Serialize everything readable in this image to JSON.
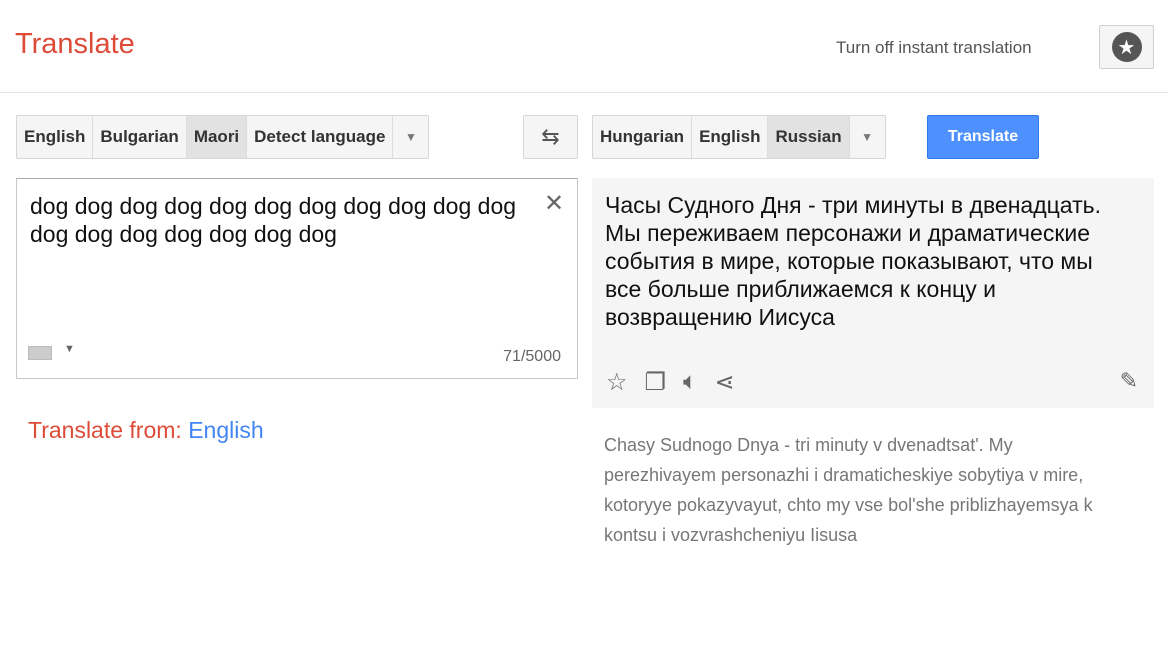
{
  "header": {
    "title": "Translate",
    "instant_toggle": "Turn off instant translation",
    "star_icon": "star-circle-icon"
  },
  "source_langs": {
    "items": [
      "English",
      "Bulgarian",
      "Maori",
      "Detect language"
    ],
    "selected": "Maori"
  },
  "target_langs": {
    "items": [
      "Hungarian",
      "English",
      "Russian"
    ],
    "selected": "Russian"
  },
  "translate_button": "Translate",
  "source": {
    "text": "dog dog dog dog dog dog dog dog dog dog dog dog dog dog dog dog dog dog",
    "count": "71/5000"
  },
  "output": {
    "text": "Часы Судного Дня - три минуты в двенадцать. Мы переживаем персонажи и драматические события в мире, которые показывают, что мы все больше приближаемся к концу и возвращению Иисуса",
    "transliteration": "Chasy Sudnogo Dnya - tri minuty v dvenadtsat'. My perezhivayem personazhi i dramaticheskiye sobytiya v mire, kotoryye pokazyvayut, chto my vse bol'she priblizhayemsya k kontsu i vozvrashcheniyu Iisusa"
  },
  "translate_from": {
    "label": "Translate from:",
    "language": "English"
  },
  "colors": {
    "brand_red": "#dd4b39",
    "button_blue": "#4d90fe",
    "link_blue": "#4285f4"
  }
}
